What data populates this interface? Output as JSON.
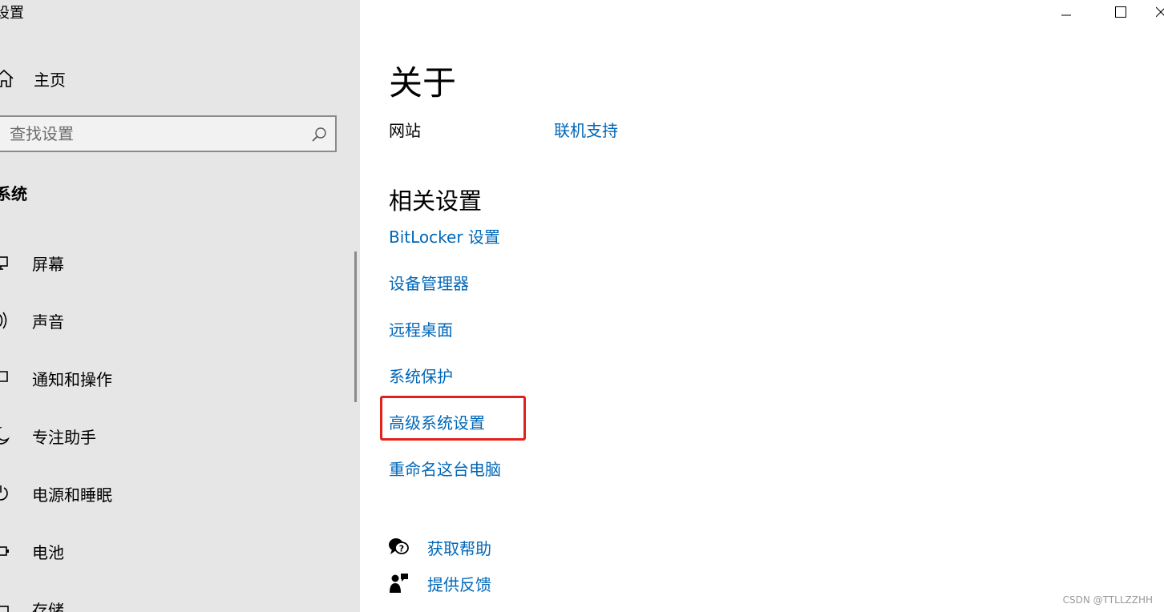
{
  "window": {
    "title": "设置",
    "controls": [
      "minimize",
      "maximize",
      "close"
    ]
  },
  "sidebar": {
    "home_label": "主页",
    "search": {
      "placeholder": "查找设置"
    },
    "section_label": "系统",
    "items": [
      {
        "label": "屏幕",
        "icon": "monitor-icon"
      },
      {
        "label": "声音",
        "icon": "speaker-icon"
      },
      {
        "label": "通知和操作",
        "icon": "notification-icon"
      },
      {
        "label": "专注助手",
        "icon": "moon-icon"
      },
      {
        "label": "电源和睡眠",
        "icon": "power-icon"
      },
      {
        "label": "电池",
        "icon": "battery-icon"
      },
      {
        "label": "存储",
        "icon": "storage-icon"
      }
    ]
  },
  "main": {
    "title": "关于",
    "website_label": "网站",
    "website_link": "联机支持",
    "related_title": "相关设置",
    "related_links": [
      "BitLocker 设置",
      "设备管理器",
      "远程桌面",
      "系统保护",
      "高级系统设置",
      "重命名这台电脑"
    ],
    "help": {
      "get_help": "获取帮助",
      "feedback": "提供反馈"
    }
  },
  "annotation": {
    "highlight_color": "#e3211c",
    "highlighted_item": "高级系统设置"
  },
  "watermark": "CSDN @TTLLZZHH",
  "colors": {
    "link": "#0067b8",
    "sidebar_bg": "#e6e6e6"
  }
}
